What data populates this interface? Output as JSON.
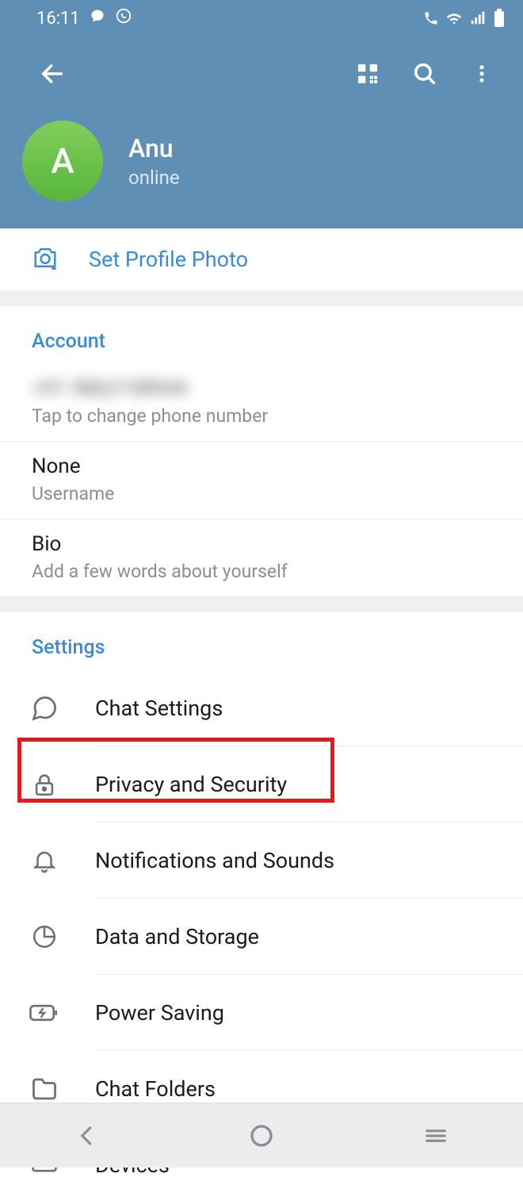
{
  "status": {
    "time": "16:11"
  },
  "profile": {
    "avatar_letter": "A",
    "name": "Anu",
    "status": "online"
  },
  "set_photo": {
    "label": "Set Profile Photo"
  },
  "account": {
    "title": "Account",
    "phone_value": "+91 9862198944",
    "phone_sub": "Tap to change phone number",
    "username_value": "None",
    "username_sub": "Username",
    "bio_value": "Bio",
    "bio_sub": "Add a few words about yourself"
  },
  "settings": {
    "title": "Settings",
    "items": [
      {
        "label": "Chat Settings"
      },
      {
        "label": "Privacy and Security"
      },
      {
        "label": "Notifications and Sounds"
      },
      {
        "label": "Data and Storage"
      },
      {
        "label": "Power Saving"
      },
      {
        "label": "Chat Folders"
      },
      {
        "label": "Devices"
      }
    ]
  }
}
